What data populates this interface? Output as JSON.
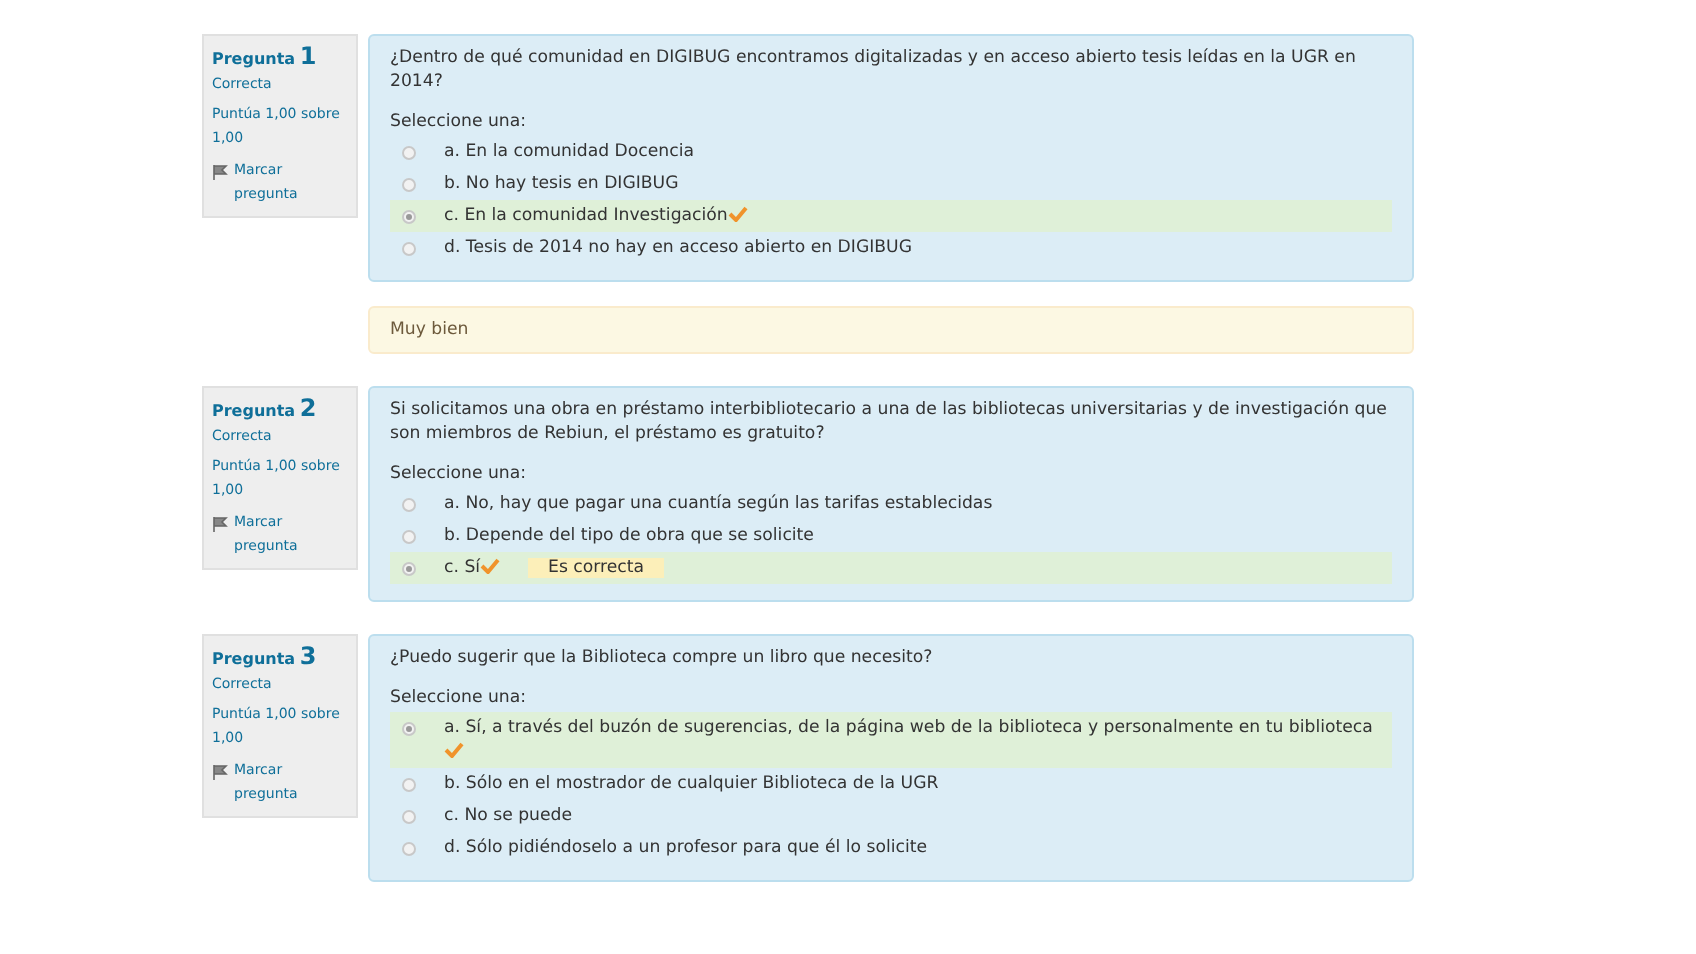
{
  "questions": [
    {
      "label": "Pregunta",
      "number": "1",
      "state": "Correcta",
      "grade": "Puntúa 1,00 sobre 1,00",
      "flag": "Marcar pregunta",
      "text": "¿Dentro de qué comunidad en DIGIBUG encontramos digitalizadas y en acceso abierto tesis leídas en la UGR en 2014?",
      "prompt": "Seleccione una:",
      "options": [
        {
          "text": "a. En la comunidad Docencia",
          "selected": false,
          "correct": false
        },
        {
          "text": "b. No hay tesis en DIGIBUG",
          "selected": false,
          "correct": false
        },
        {
          "text": "c. En la comunidad Investigación",
          "selected": true,
          "correct": true
        },
        {
          "text": "d. Tesis de 2014 no hay en acceso abierto en DIGIBUG",
          "selected": false,
          "correct": false
        }
      ],
      "feedback": "Muy bien"
    },
    {
      "label": "Pregunta",
      "number": "2",
      "state": "Correcta",
      "grade": "Puntúa 1,00 sobre 1,00",
      "flag": "Marcar pregunta",
      "text": "Si solicitamos una obra en préstamo interbibliotecario a una de las bibliotecas universitarias y de investigación que son miembros de Rebiun, el préstamo es gratuito?",
      "prompt": "Seleccione una:",
      "options": [
        {
          "text": "a. No, hay que pagar una cuantía según las tarifas establecidas",
          "selected": false,
          "correct": false
        },
        {
          "text": "b. Depende del tipo de obra que se solicite",
          "selected": false,
          "correct": false
        },
        {
          "text": "c. Sí",
          "selected": true,
          "correct": true,
          "note": "Es correcta"
        }
      ]
    },
    {
      "label": "Pregunta",
      "number": "3",
      "state": "Correcta",
      "grade": "Puntúa 1,00 sobre 1,00",
      "flag": "Marcar pregunta",
      "text": "¿Puedo sugerir que la Biblioteca compre un libro que necesito?",
      "prompt": "Seleccione una:",
      "options": [
        {
          "text": "a. Sí, a través del buzón de sugerencias, de la página web de la biblioteca y personalmente en tu biblioteca",
          "selected": true,
          "correct": true
        },
        {
          "text": "b. Sólo en el mostrador de cualquier Biblioteca de la UGR",
          "selected": false,
          "correct": false
        },
        {
          "text": "c. No se puede",
          "selected": false,
          "correct": false
        },
        {
          "text": "d. Sólo pidiéndoselo a un profesor para que él lo solicite",
          "selected": false,
          "correct": false
        }
      ]
    }
  ]
}
